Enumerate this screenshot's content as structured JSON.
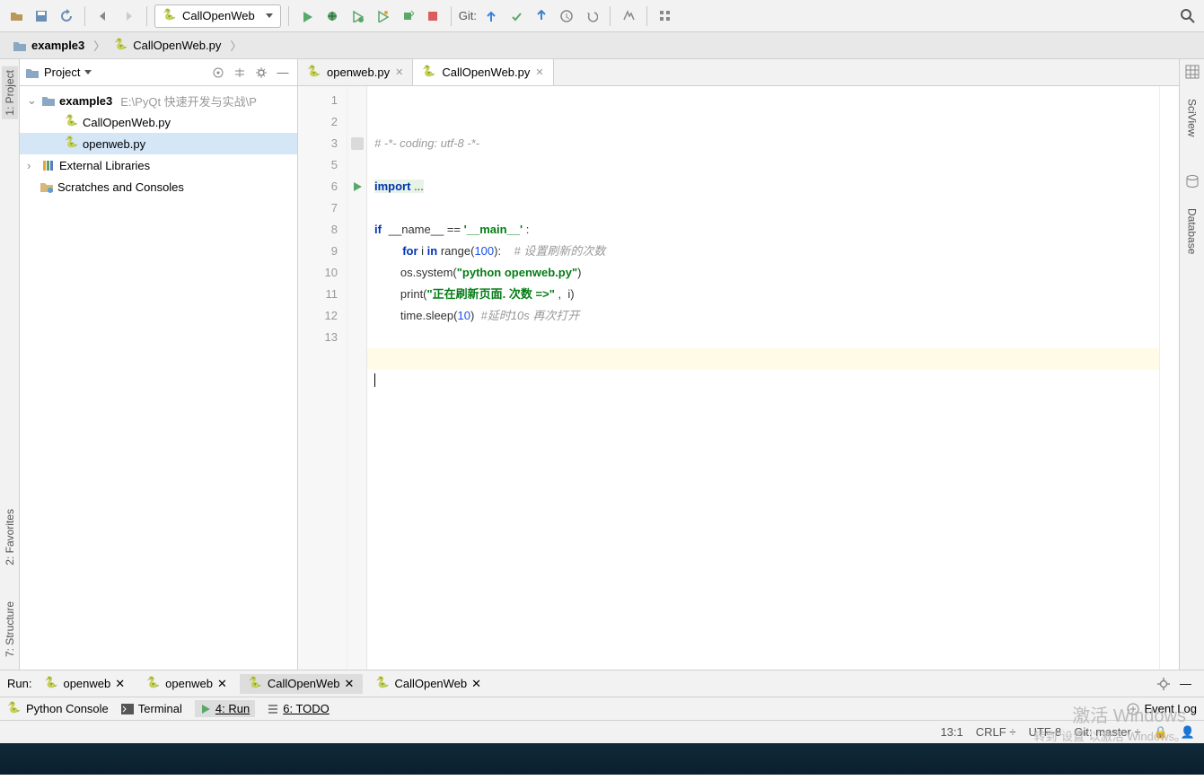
{
  "toolbar": {
    "run_config": "CallOpenWeb",
    "git_label": "Git:"
  },
  "breadcrumb": {
    "root": "example3",
    "file": "CallOpenWeb.py"
  },
  "project": {
    "title": "Project",
    "root": {
      "name": "example3",
      "path": "E:\\PyQt 快速开发与实战\\P"
    },
    "files": [
      "CallOpenWeb.py",
      "openweb.py"
    ],
    "external": "External Libraries",
    "scratches": "Scratches and Consoles"
  },
  "tabs": [
    {
      "name": "openweb.py",
      "active": false
    },
    {
      "name": "CallOpenWeb.py",
      "active": true
    }
  ],
  "code": {
    "l1": "# -*- coding: utf-8 -*-",
    "l3": "import ...",
    "l6_if": "if",
    "l6_name": "__name__",
    "l6_eq": " == ",
    "l6_main": "'__main__'",
    "l6_end": " :",
    "l7_for": "for",
    "l7_i": " i ",
    "l7_in": "in",
    "l7_range": " range",
    "l7_args": "(100):",
    "l7_cm": "    # 设置刷新的次数",
    "l8": "        os.system(",
    "l8_str": "\"python openweb.py\"",
    "l8_end": ")",
    "l9": "        print(",
    "l9_str": "\"正在刷新页面. 次数 =>\"",
    "l9_end": " ,  i)",
    "l10": "        time.sleep(",
    "l10_num": "10",
    "l10_end": ")  ",
    "l10_cm": "#延时10s 再次打开"
  },
  "line_numbers": [
    "1",
    "2",
    "3",
    "5",
    "6",
    "7",
    "8",
    "9",
    "10",
    "11",
    "12",
    "13"
  ],
  "run_panel": {
    "label": "Run:",
    "tabs": [
      "openweb",
      "openweb",
      "CallOpenWeb",
      "CallOpenWeb"
    ],
    "active_index": 2
  },
  "bottom": {
    "python_console": "Python Console",
    "terminal": "Terminal",
    "run": "4: Run",
    "todo": "6: TODO",
    "event_log": "Event Log"
  },
  "status": {
    "pos": "13:1",
    "eol": "CRLF",
    "enc": "UTF-8",
    "git": "Git: master"
  },
  "left_tabs": {
    "project": "1: Project",
    "favorites": "2: Favorites",
    "structure": "7: Structure"
  },
  "right_tabs": {
    "sciview": "SciView",
    "database": "Database"
  },
  "watermark": {
    "l1": "激活 Windows",
    "l2": "转到\"设置\"以激活 Windows。"
  }
}
